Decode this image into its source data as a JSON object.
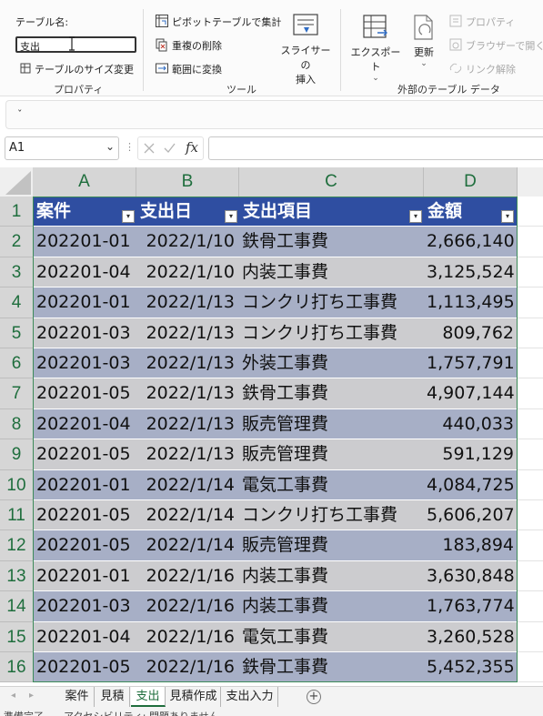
{
  "ribbon": {
    "properties": {
      "table_name_label": "テーブル名:",
      "table_name_value": "支出",
      "resize_table_label": "テーブルのサイズ変更",
      "group_label": "プロパティ"
    },
    "tools": {
      "pivot_summary_label": "ピボットテーブルで集計",
      "remove_duplicates_label": "重複の削除",
      "convert_to_range_label": "範囲に変換",
      "slicer_line1": "スライサーの",
      "slicer_line2": "挿入",
      "group_label": "ツール"
    },
    "external": {
      "export_label": "エクスポート",
      "refresh_label": "更新",
      "properties_label": "プロパティ",
      "open_in_browser_label": "ブラウザーで開く",
      "unlink_label": "リンク解除",
      "group_label": "外部のテーブル データ"
    },
    "collapse_chevron": "ˇ"
  },
  "formula_bar": {
    "name_box": "A1",
    "fx_label": "fx",
    "value": ""
  },
  "columns": [
    "A",
    "B",
    "C",
    "D"
  ],
  "table": {
    "headers": [
      "案件",
      "支出日",
      "支出項目",
      "金額"
    ],
    "rows": [
      [
        "202201-01",
        "2022/1/10",
        "鉄骨工事費",
        "2,666,140"
      ],
      [
        "202201-04",
        "2022/1/10",
        "内装工事費",
        "3,125,524"
      ],
      [
        "202201-01",
        "2022/1/13",
        "コンクリ打ち工事費",
        "1,113,495"
      ],
      [
        "202201-03",
        "2022/1/13",
        "コンクリ打ち工事費",
        "809,762"
      ],
      [
        "202201-03",
        "2022/1/13",
        "外装工事費",
        "1,757,791"
      ],
      [
        "202201-05",
        "2022/1/13",
        "鉄骨工事費",
        "4,907,144"
      ],
      [
        "202201-04",
        "2022/1/13",
        "販売管理費",
        "440,033"
      ],
      [
        "202201-05",
        "2022/1/13",
        "販売管理費",
        "591,129"
      ],
      [
        "202201-01",
        "2022/1/14",
        "電気工事費",
        "4,084,725"
      ],
      [
        "202201-05",
        "2022/1/14",
        "コンクリ打ち工事費",
        "5,606,207"
      ],
      [
        "202201-05",
        "2022/1/14",
        "販売管理費",
        "183,894"
      ],
      [
        "202201-01",
        "2022/1/16",
        "内装工事費",
        "3,630,848"
      ],
      [
        "202201-03",
        "2022/1/16",
        "内装工事費",
        "1,763,774"
      ],
      [
        "202201-04",
        "2022/1/16",
        "電気工事費",
        "3,260,528"
      ],
      [
        "202201-05",
        "2022/1/16",
        "鉄骨工事費",
        "5,452,355"
      ]
    ]
  },
  "row_numbers": [
    "1",
    "2",
    "3",
    "4",
    "5",
    "6",
    "7",
    "8",
    "9",
    "10",
    "11",
    "12",
    "13",
    "14",
    "15",
    "16"
  ],
  "sheet_tabs": [
    {
      "label": "案件",
      "active": false
    },
    {
      "label": "見積",
      "active": false
    },
    {
      "label": "支出",
      "active": true
    },
    {
      "label": "見積作成",
      "active": false
    },
    {
      "label": "支出入力",
      "active": false
    }
  ],
  "add_sheet_label": "+",
  "status_text": "準備完了　　アクセシビリティ: 問題ありません",
  "colors": {
    "header_bg": "#2f4ea1",
    "band_dark": "#a7afc6",
    "band_light": "#cccccf",
    "accent_green": "#1f6e3d"
  }
}
